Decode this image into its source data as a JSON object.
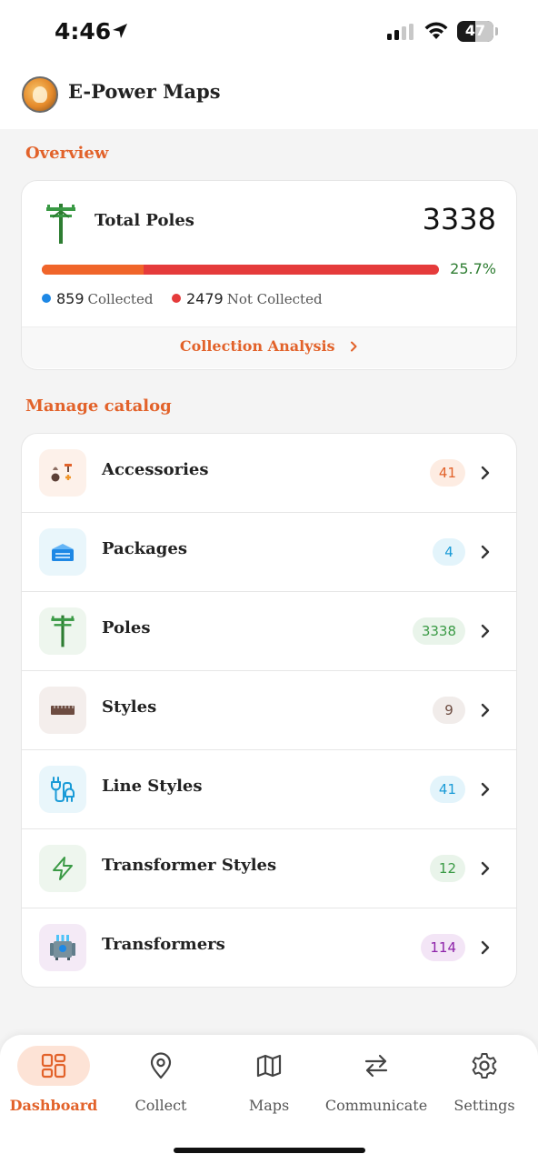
{
  "status_bar": {
    "time": "4:46",
    "battery": "47"
  },
  "app": {
    "title": "E-Power Maps"
  },
  "overview": {
    "section_title": "Overview",
    "total_label": "Total Poles",
    "total_count": "3338",
    "collected_fraction": 0.257,
    "percent_label": "25.7%",
    "collected_count": "859",
    "collected_label": "Collected",
    "not_collected_count": "2479",
    "not_collected_label": "Not Collected",
    "analysis_link": "Collection Analysis"
  },
  "catalog": {
    "section_title": "Manage catalog",
    "items": [
      {
        "label": "Accessories",
        "count": "41",
        "icon": "accessories-icon",
        "bg": "#fdf1ea",
        "badge_bg": "#fdece2",
        "badge_color": "#e2622a"
      },
      {
        "label": "Packages",
        "count": "4",
        "icon": "package-icon",
        "bg": "#e9f6fb",
        "badge_bg": "#e3f4fb",
        "badge_color": "#1a9bd7"
      },
      {
        "label": "Poles",
        "count": "3338",
        "icon": "pole-icon",
        "bg": "#eef6ee",
        "badge_bg": "#e9f4ea",
        "badge_color": "#3a9a45"
      },
      {
        "label": "Styles",
        "count": "9",
        "icon": "styles-icon",
        "bg": "#f4eeec",
        "badge_bg": "#f1ecea",
        "badge_color": "#6d4c41"
      },
      {
        "label": "Line Styles",
        "count": "41",
        "icon": "plug-icon",
        "bg": "#e9f6fb",
        "badge_bg": "#e3f4fb",
        "badge_color": "#1a9bd7"
      },
      {
        "label": "Transformer Styles",
        "count": "12",
        "icon": "lightning-icon",
        "bg": "#eef6ee",
        "badge_bg": "#e9f4ea",
        "badge_color": "#3a9a45"
      },
      {
        "label": "Transformers",
        "count": "114",
        "icon": "transformer-icon",
        "bg": "#f4eaf6",
        "badge_bg": "#f3e5f6",
        "badge_color": "#8e24aa"
      }
    ]
  },
  "nav": {
    "items": [
      {
        "label": "Dashboard",
        "icon": "dashboard-icon",
        "active": true
      },
      {
        "label": "Collect",
        "icon": "location-pin-icon",
        "active": false
      },
      {
        "label": "Maps",
        "icon": "map-icon",
        "active": false
      },
      {
        "label": "Communicate",
        "icon": "swap-arrows-icon",
        "active": false
      },
      {
        "label": "Settings",
        "icon": "gear-icon",
        "active": false
      }
    ]
  },
  "colors": {
    "accent": "#e2622a",
    "progress_collected": "#f0652a",
    "progress_remaining": "#e53b3b",
    "collected_dot": "#1e88e5",
    "not_collected_dot": "#e53b3b",
    "percent": "#2e7d32"
  }
}
